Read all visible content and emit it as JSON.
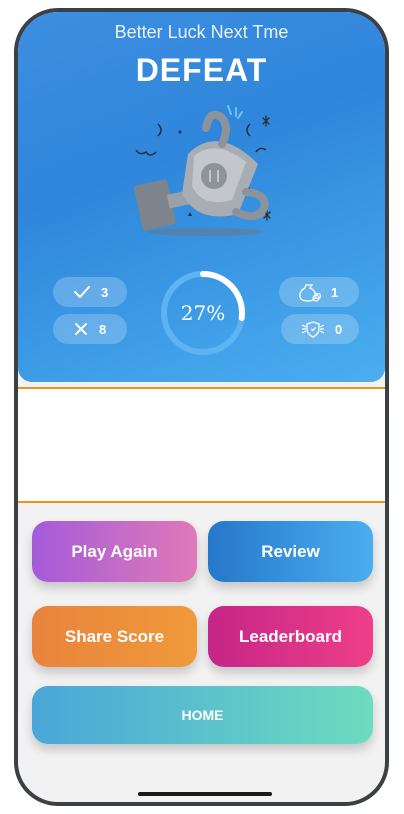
{
  "header": {
    "subtitle": "Better Luck Next Tme",
    "title": "DEFEAT"
  },
  "stats": {
    "correct": {
      "icon": "checkmark-icon",
      "value": "3"
    },
    "wrong": {
      "icon": "cross-icon",
      "value": "8"
    },
    "coins": {
      "icon": "money-bag-icon",
      "value": "1"
    },
    "badges": {
      "icon": "shield-badge-icon",
      "value": "0"
    },
    "score": {
      "label": "27%",
      "fraction": 0.27
    }
  },
  "buttons": {
    "play_again": "Play Again",
    "review": "Review",
    "share_score": "Share Score",
    "leaderboard": "Leaderboard",
    "home": "HOME"
  },
  "colors": {
    "header_blue": "#2f86db",
    "ad_border_orange": "#f0931e"
  }
}
